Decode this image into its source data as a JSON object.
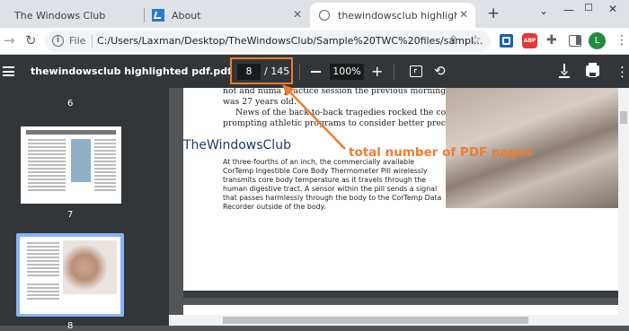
{
  "tabs": [
    {
      "title": "The Windows Club"
    },
    {
      "title": "About"
    },
    {
      "title": "thewindowsclub highlighted pdf"
    }
  ],
  "address": {
    "scheme_label": "File",
    "url": "C:/Users/Laxman/Desktop/TheWindowsClub/Sample%20TWC%20files/sampl..."
  },
  "profile_initial": "L",
  "adblock_badge": "ABP",
  "pdf_toolbar": {
    "title": "thewindowsclub highlighted pdf.pdf",
    "current_page": "8",
    "total_pages": "/ 145",
    "zoom": "100%"
  },
  "thumbnails": [
    {
      "label": "6"
    },
    {
      "label": "7"
    },
    {
      "label": "8"
    }
  ],
  "page_text": {
    "serif_lines": [
      "not and numa practice session the previous morning. He",
      "was 27 years old.",
      "News of the back-to-back tragedies rocked the country,",
      "prompting athletic programs to consider better precautions"
    ],
    "sans_lines": [
      "At three-fourths of an inch, the commercially available",
      "CorTemp Ingestible Core Body Thermometer Pill wirelessly",
      "transmits core body temperature as it travels through the",
      "human digestive tract. A sensor within the pill sends a signal",
      "that passes harmlessly through the body to the CorTemp Data",
      "Recorder outside of the body."
    ]
  },
  "watermark": "TheWindowsClub",
  "annotation": "total number of PDF pages",
  "colors": {
    "annotation": "#ed7d31",
    "toolbar": "#323639",
    "viewer_bg": "#525659"
  }
}
